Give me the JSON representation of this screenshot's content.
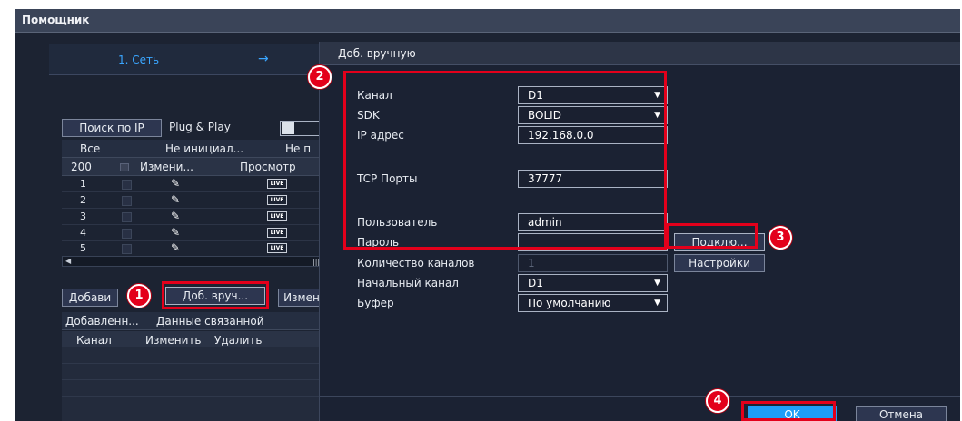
{
  "window": {
    "title": "Помощник"
  },
  "wizard": {
    "step_label": "1. Сеть",
    "step_arrow": "→"
  },
  "toolbar": {
    "search_ip": "Поиск по IP",
    "plug_play": "Plug & Play"
  },
  "filter_tabs": [
    "Все",
    "Не инициал...",
    "Не п"
  ],
  "device_table": {
    "headers": [
      "200",
      "Измени...",
      "Просмотр"
    ],
    "rows": [
      {
        "num": "1",
        "live": "LIVE"
      },
      {
        "num": "2",
        "live": "LIVE"
      },
      {
        "num": "3",
        "live": "LIVE"
      },
      {
        "num": "4",
        "live": "LIVE"
      },
      {
        "num": "5",
        "live": "LIVE"
      }
    ]
  },
  "actions": {
    "add": "Добави",
    "manual_add": "Доб. вруч...",
    "modify": "Измен"
  },
  "added_tabs": [
    "Добавленн...",
    "Данные связанной"
  ],
  "added_table": {
    "headers": [
      "Канал",
      "Изменить",
      "Удалить"
    ]
  },
  "dialog": {
    "title": "Доб. вручную",
    "channel": {
      "label": "Канал",
      "value": "D1"
    },
    "sdk": {
      "label": "SDK",
      "value": "BOLID"
    },
    "ip": {
      "label": "IP адрес",
      "value": "192.168.0.0"
    },
    "tcp": {
      "label": "TCP Порты",
      "value": "37777"
    },
    "user": {
      "label": "Пользователь",
      "value": "admin"
    },
    "password": {
      "label": "Пароль",
      "value": ""
    },
    "connect_button": "Подклю...",
    "channel_count": {
      "label": "Количество каналов",
      "value": "1"
    },
    "settings_button": "Настройки",
    "start_channel": {
      "label": "Начальный канал",
      "value": "D1"
    },
    "buffer": {
      "label": "Буфер",
      "value": "По умолчанию"
    },
    "ok": "OK",
    "cancel": "Отмена"
  },
  "callouts": [
    "1",
    "2",
    "3",
    "4"
  ],
  "colors": {
    "highlight": "#e3001b",
    "accent": "#1e9df8",
    "step_text": "#3aa6ff"
  }
}
